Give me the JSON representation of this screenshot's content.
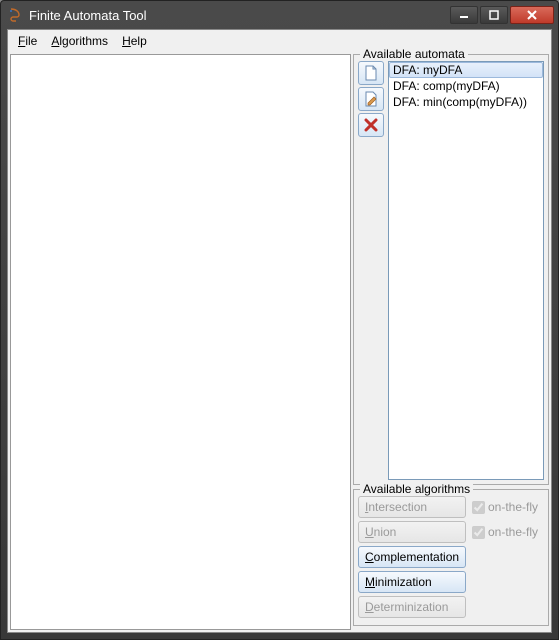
{
  "window": {
    "title": "Finite Automata Tool"
  },
  "menu": {
    "file": "File",
    "algorithms": "Algorithms",
    "help": "Help"
  },
  "panels": {
    "automata_title": "Available automata",
    "algorithms_title": "Available algorithms"
  },
  "automata": {
    "items": [
      {
        "label": "DFA: myDFA",
        "selected": true
      },
      {
        "label": "DFA: comp(myDFA)",
        "selected": false
      },
      {
        "label": "DFA: min(comp(myDFA))",
        "selected": false
      }
    ]
  },
  "toolbar": {
    "new_icon": "new",
    "edit_icon": "edit",
    "delete_icon": "delete"
  },
  "algorithms": {
    "intersection": {
      "label": "Intersection",
      "enabled": false,
      "onthefly_label": "on-the-fly",
      "onthefly_checked": true
    },
    "union": {
      "label": "Union",
      "enabled": false,
      "onthefly_label": "on-the-fly",
      "onthefly_checked": true
    },
    "complementation": {
      "label": "Complementation",
      "enabled": true
    },
    "minimization": {
      "label": "Minimization",
      "enabled": true
    },
    "determinization": {
      "label": "Determinization",
      "enabled": false
    }
  }
}
